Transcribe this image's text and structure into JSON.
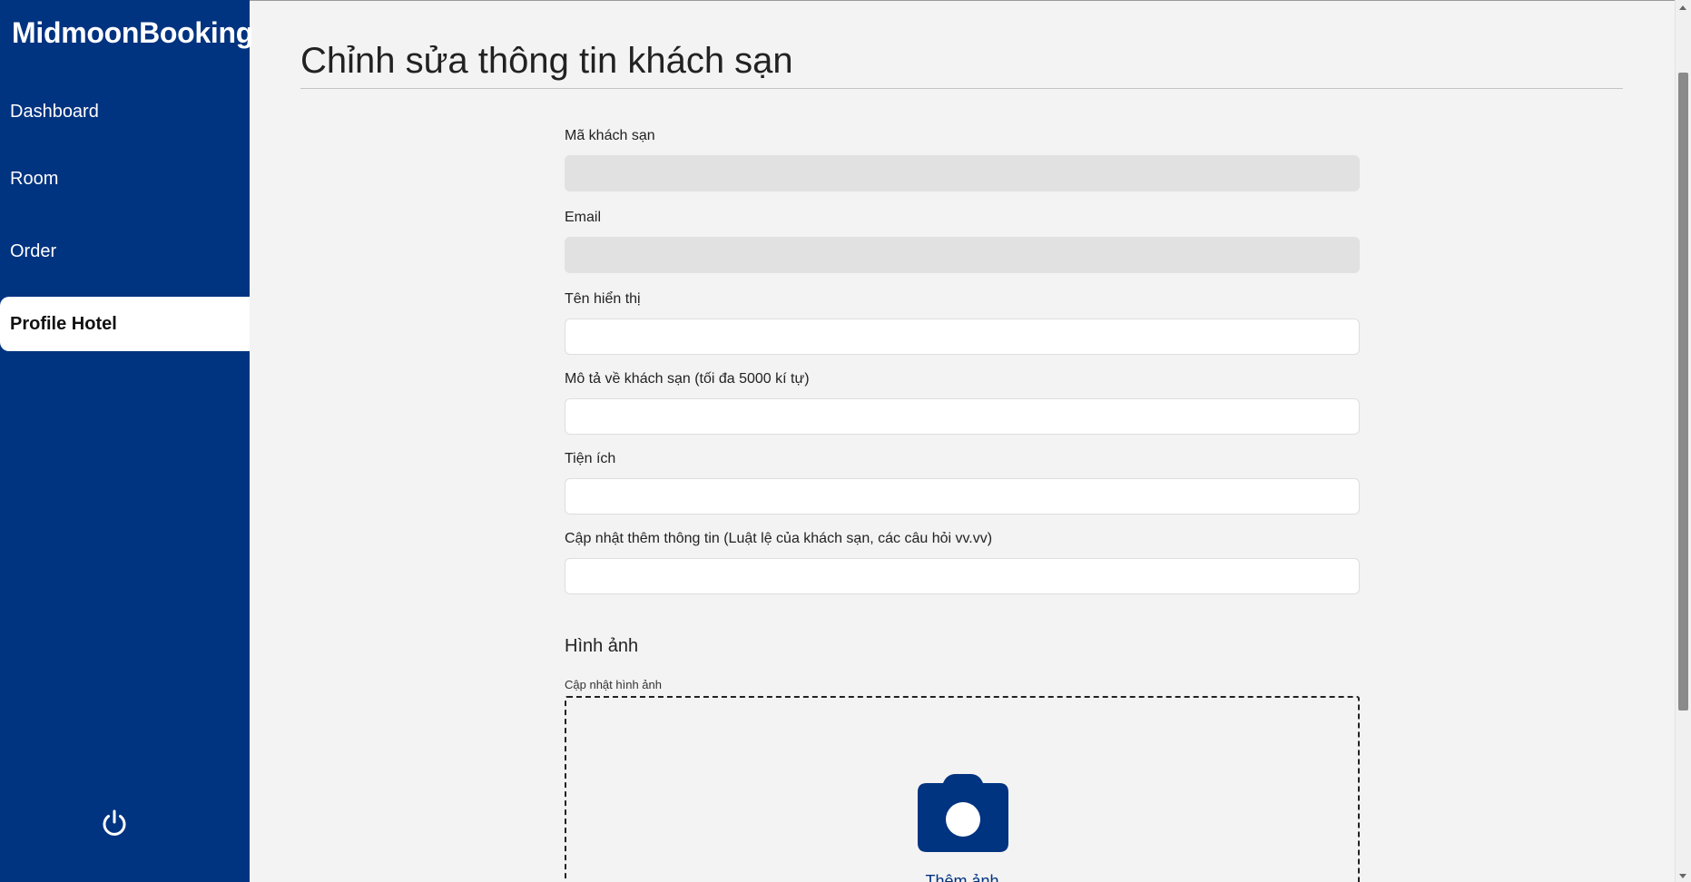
{
  "sidebar": {
    "brand": "MidmoonBooking",
    "items": [
      {
        "label": "Dashboard"
      },
      {
        "label": "Room"
      },
      {
        "label": "Order"
      },
      {
        "label": "Profile Hotel",
        "active": true
      }
    ],
    "logout_icon": "power-icon"
  },
  "main": {
    "page_title": "Chỉnh sửa thông tin khách sạn",
    "form": {
      "hotel_id": {
        "label": "Mã khách sạn",
        "value": "",
        "disabled": true
      },
      "email": {
        "label": "Email",
        "value": "",
        "disabled": true
      },
      "display_name": {
        "label": "Tên hiển thị",
        "value": ""
      },
      "description": {
        "label": "Mô tả về khách sạn (tối đa 5000 kí tự)",
        "value": ""
      },
      "amenities": {
        "label": "Tiện ích",
        "value": ""
      },
      "extra_info": {
        "label": "Cập nhật thêm thông tin (Luật lệ của khách sạn, các câu hỏi vv.vv)",
        "value": ""
      }
    },
    "images": {
      "section_title": "Hình ảnh",
      "upload_label": "Cập nhật hình ảnh",
      "add_photo_label": "Thêm ảnh",
      "add_photo_icon": "camera-icon"
    }
  },
  "colors": {
    "sidebar_bg": "#003380",
    "accent": "#003380",
    "page_bg": "#f3f3f3",
    "disabled_field": "#e1e1e1"
  }
}
